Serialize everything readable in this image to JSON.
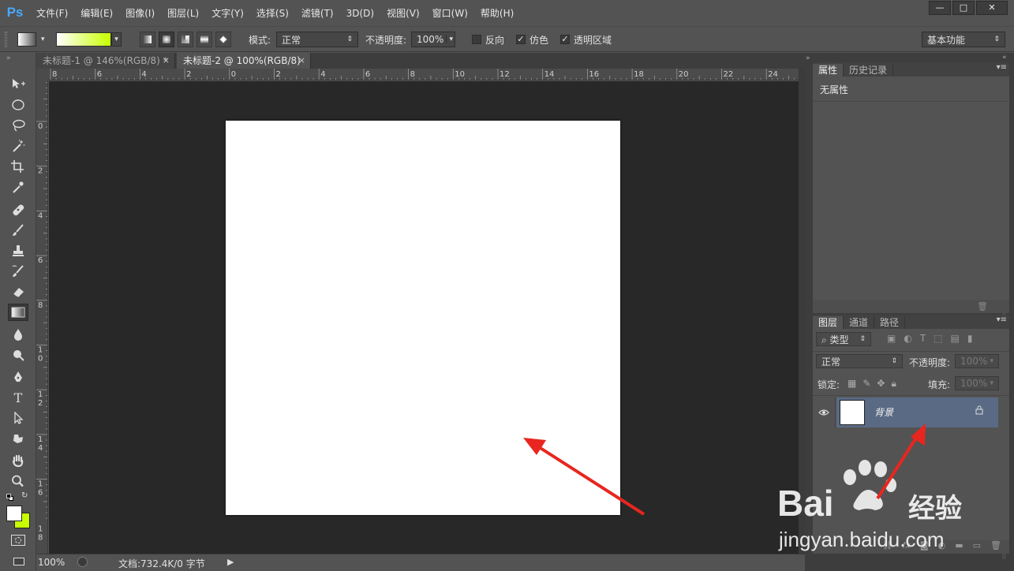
{
  "app": {
    "logo": "Ps"
  },
  "menu": [
    "文件(F)",
    "编辑(E)",
    "图像(I)",
    "图层(L)",
    "文字(Y)",
    "选择(S)",
    "滤镜(T)",
    "3D(D)",
    "视图(V)",
    "窗口(W)",
    "帮助(H)"
  ],
  "window_controls": {
    "minimize": "—",
    "maximize": "□",
    "close": "✕"
  },
  "options": {
    "mode_label": "模式:",
    "mode_value": "正常",
    "opacity_label": "不透明度:",
    "opacity_value": "100%",
    "reverse_label": "反向",
    "dither_label": "仿色",
    "transparency_label": "透明区域",
    "workspace": "基本功能",
    "gradient_colors": [
      "#ffffff",
      "#c8ff00"
    ]
  },
  "tabs": [
    {
      "title": "未标题-1 @ 146%(RGB/8) *",
      "close": "×"
    },
    {
      "title": "未标题-2 @ 100%(RGB/8)",
      "close": "×"
    }
  ],
  "ruler_h": [
    "8",
    "6",
    "4",
    "2",
    "0",
    "2",
    "4",
    "6",
    "8",
    "10",
    "12",
    "14",
    "16",
    "18",
    "20",
    "22",
    "24"
  ],
  "ruler_v": [
    "0",
    "2",
    "4",
    "6",
    "8",
    "1\n0",
    "1\n2",
    "1\n4",
    "1\n6",
    "1\n8"
  ],
  "status": {
    "zoom": "100%",
    "doc_info": "文档:732.4K/0 字节"
  },
  "properties_panel": {
    "tabs": [
      "属性",
      "历史记录"
    ],
    "content": "无属性"
  },
  "layers_panel": {
    "tabs": [
      "图层",
      "通道",
      "路径"
    ],
    "filter_kind": "类型",
    "blend_mode": "正常",
    "opacity_label": "不透明度:",
    "opacity_value": "100%",
    "lock_label": "锁定:",
    "fill_label": "填充:",
    "fill_value": "100%",
    "layers": [
      {
        "name": "背景",
        "visible": true,
        "locked": true
      }
    ]
  },
  "colors": {
    "foreground": "#ffffff",
    "background": "#c8ff00",
    "arrow": "#e8261f",
    "selected_layer": "#5a6a84"
  },
  "watermark": {
    "brand": "Bai",
    "brand2": "经验",
    "url": "jingyan.baidu.com"
  }
}
